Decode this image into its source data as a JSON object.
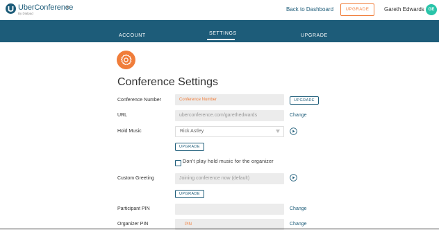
{
  "brand": {
    "name": "UberConference",
    "subtitle": "By Dialpad"
  },
  "header": {
    "back_link": "Back to Dashboard",
    "upgrade_label": "UPGRADE",
    "user_name": "Gareth Edwards",
    "avatar_initials": "GE"
  },
  "nav": {
    "tabs": [
      {
        "label": "ACCOUNT",
        "active": false
      },
      {
        "label": "SETTINGS",
        "active": true
      },
      {
        "label": "UPGRADE",
        "active": false
      }
    ]
  },
  "page": {
    "title": "Conference Settings"
  },
  "settings": {
    "conference_number": {
      "label": "Conference Number",
      "placeholder": "Conference Number",
      "upgrade_label": "UPGRADE"
    },
    "url": {
      "label": "URL",
      "value": "uberconference.com/garethedwards",
      "action": "Change"
    },
    "hold_music": {
      "label": "Hold Music",
      "selected": "Rick Astley",
      "upgrade_label": "UPGRADE",
      "checkbox_label": "Don't play hold music for the organizer",
      "checked": false
    },
    "custom_greeting": {
      "label": "Custom Greeting",
      "placeholder": "Joining conference now (default)",
      "upgrade_label": "UPGRADE"
    },
    "participant_pin": {
      "label": "Participant PIN",
      "value": "",
      "action": "Change"
    },
    "organizer_pin": {
      "label": "Organizer PIN",
      "placeholder": "PIN",
      "action": "Change"
    }
  },
  "colors": {
    "brand_blue": "#1d5c79",
    "accent_orange": "#f07d3a",
    "avatar_teal": "#29c4a9"
  }
}
